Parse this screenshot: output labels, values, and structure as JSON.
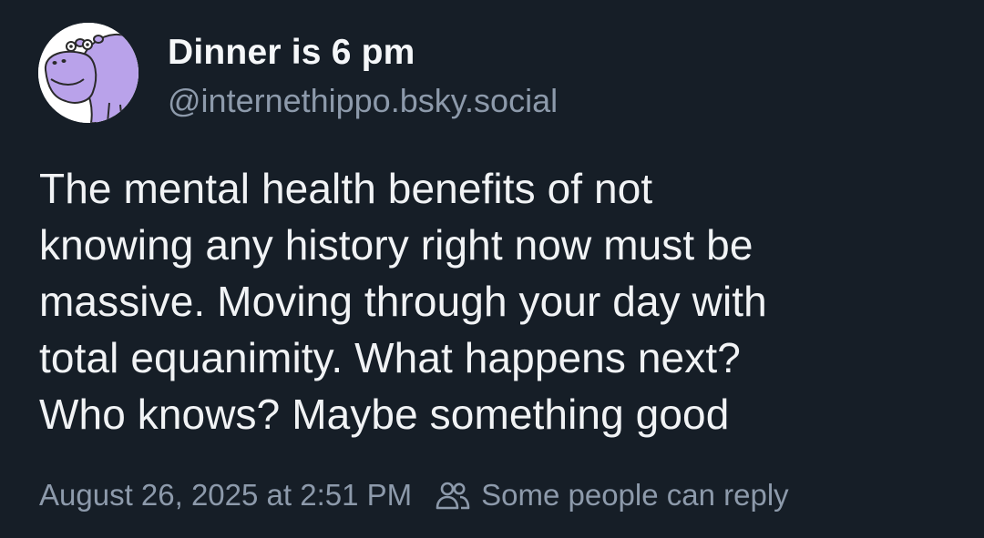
{
  "author": {
    "display_name": "Dinner is 6 pm",
    "handle": "@internethippo.bsky.social",
    "avatar_icon": "purple-hippo-avatar"
  },
  "post": {
    "text_lines": [
      "The mental health benefits of not",
      "knowing any history right now must be",
      "massive. Moving through your day with",
      "total equanimity. What happens next?",
      "Who knows? Maybe something good"
    ]
  },
  "meta": {
    "timestamp": "August 26, 2025 at 2:51 PM",
    "reply_setting_label": "Some people can reply",
    "reply_setting_icon": "people-icon"
  },
  "colors": {
    "background": "#161e27",
    "text_primary": "#f1f3f5",
    "text_secondary": "#8d9aab",
    "avatar_accent": "#b9a2ea"
  }
}
